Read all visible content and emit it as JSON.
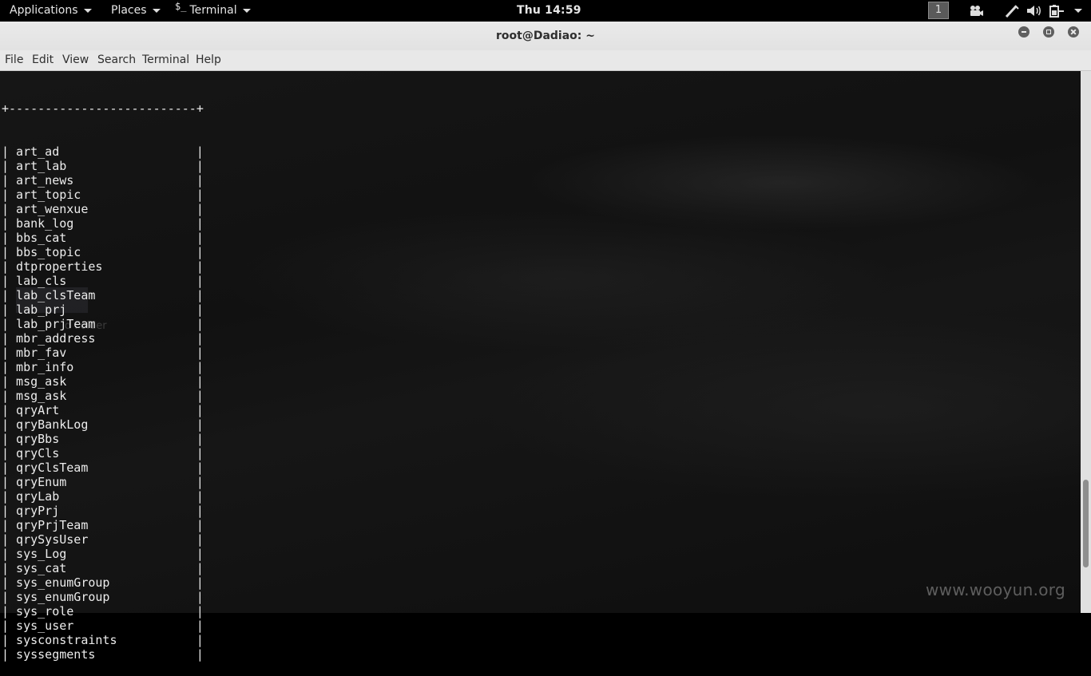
{
  "topbar": {
    "applications_label": "Applications",
    "places_label": "Places",
    "terminal_label": "Terminal",
    "terminal_glyph": "$_",
    "clock": "Thu 14:59",
    "workspace": "1",
    "icons": [
      "camera-icon",
      "pen-icon",
      "volume-icon",
      "battery-icon",
      "power-menu-arrow-icon"
    ]
  },
  "window": {
    "title": "root@Dadiao: ~"
  },
  "menubar": {
    "items": [
      "File",
      "Edit",
      "View",
      "Search",
      "Terminal",
      "Help"
    ]
  },
  "terminal": {
    "border_top": "+--------------------------+",
    "rows": [
      "art_ad",
      "art_lab",
      "art_news",
      "art_topic",
      "art_wenxue",
      "bank_log",
      "bbs_cat",
      "bbs_topic",
      "dtproperties",
      "lab_cls",
      "lab_clsTeam",
      "lab_prj",
      "lab_prjTeam",
      "mbr_address",
      "mbr_fav",
      "mbr_info",
      "msg_ask",
      "msg_ask",
      "qryArt",
      "qryBankLog",
      "qryBbs",
      "qryCls",
      "qryClsTeam",
      "qryEnum",
      "qryLab",
      "qryPrj",
      "qryPrjTeam",
      "qrySysUser",
      "sys_Log",
      "sys_cat",
      "sys_enumGroup",
      "sys_enumGroup",
      "sys_role",
      "sys_user",
      "sysconstraints",
      "syssegments"
    ],
    "ghost_label": "d Folder"
  },
  "scrollbar": {
    "position_fraction": 0.9
  },
  "watermark": "www.wooyun.org"
}
